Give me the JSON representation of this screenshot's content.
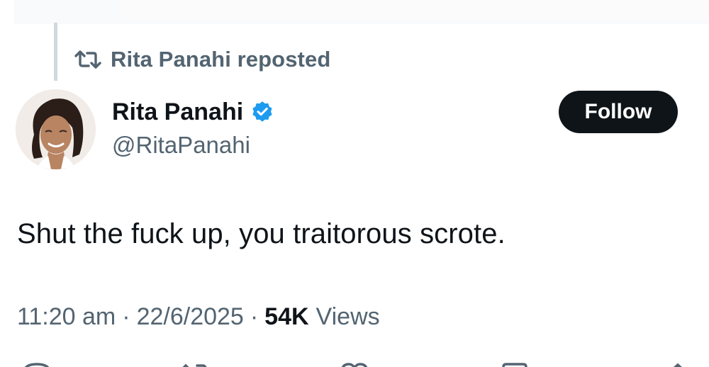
{
  "repost_context": {
    "icon": "repost-icon",
    "label": "Rita Panahi reposted"
  },
  "author": {
    "avatar": "avatar",
    "display_name": "Rita Panahi",
    "verified_icon": "verified-badge-icon",
    "handle": "@RitaPanahi",
    "follow_label": "Follow"
  },
  "tweet": {
    "text": "Shut the fuck up, you traitorous scrote.",
    "time": "11:20 am",
    "separator": "·",
    "date": "22/6/2025",
    "views_count": "54K",
    "views_label": "Views"
  },
  "actions": {
    "icons": [
      "reply-icon",
      "repost-icon",
      "like-icon",
      "bookmark-icon",
      "share-icon"
    ]
  },
  "colors": {
    "primary_text": "#0f1419",
    "secondary_text": "#536471",
    "verified_blue": "#1d9bf0",
    "follow_bg": "#0f1419",
    "follow_text": "#ffffff"
  }
}
